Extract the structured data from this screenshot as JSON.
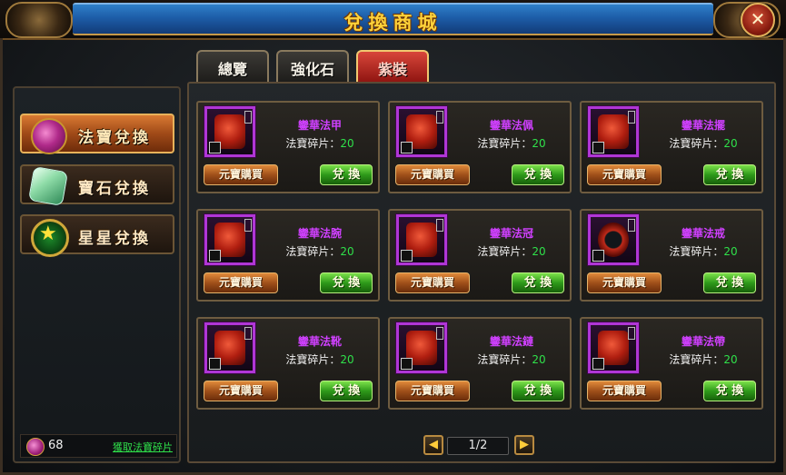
{
  "window": {
    "title": "兌換商城",
    "close_glyph": "✕"
  },
  "tabs": [
    {
      "label": "總覽",
      "active": false
    },
    {
      "label": "強化石",
      "active": false
    },
    {
      "label": "紫裝",
      "active": true
    }
  ],
  "categories": [
    {
      "label": "法寶兌換",
      "icon": "magic-treasure-icon",
      "active": true
    },
    {
      "label": "寶石兌換",
      "icon": "gem-icon",
      "active": false
    },
    {
      "label": "星星兌換",
      "icon": "star-icon",
      "active": false
    }
  ],
  "footer": {
    "shard_count": "68",
    "get_link": "獲取法寶碎片"
  },
  "item_common": {
    "cost_label": "法寶碎片：",
    "buy_label": "元寶購買",
    "exchange_label": "兌 換"
  },
  "items": [
    {
      "name": "鑾華法甲",
      "cost": "20",
      "icon": "armor-icon"
    },
    {
      "name": "鑾華法佩",
      "cost": "20",
      "icon": "pendant-icon"
    },
    {
      "name": "鑾華法擺",
      "cost": "20",
      "icon": "robe-skirt-icon"
    },
    {
      "name": "鑾華法腕",
      "cost": "20",
      "icon": "bracer-icon"
    },
    {
      "name": "鑾華法冠",
      "cost": "20",
      "icon": "crown-icon"
    },
    {
      "name": "鑾華法戒",
      "cost": "20",
      "icon": "ring-icon"
    },
    {
      "name": "鑾華法靴",
      "cost": "20",
      "icon": "boots-icon"
    },
    {
      "name": "鑾華法鏈",
      "cost": "20",
      "icon": "chain-icon"
    },
    {
      "name": "鑾華法帶",
      "cost": "20",
      "icon": "belt-icon"
    }
  ],
  "pager": {
    "text": "1/2",
    "prev_glyph": "◀",
    "next_glyph": "▶"
  },
  "colors": {
    "item_name": "#d040ff",
    "cost_value": "#2fe04a",
    "title": "#ffd23a",
    "rarity_border": "#b036d6"
  }
}
